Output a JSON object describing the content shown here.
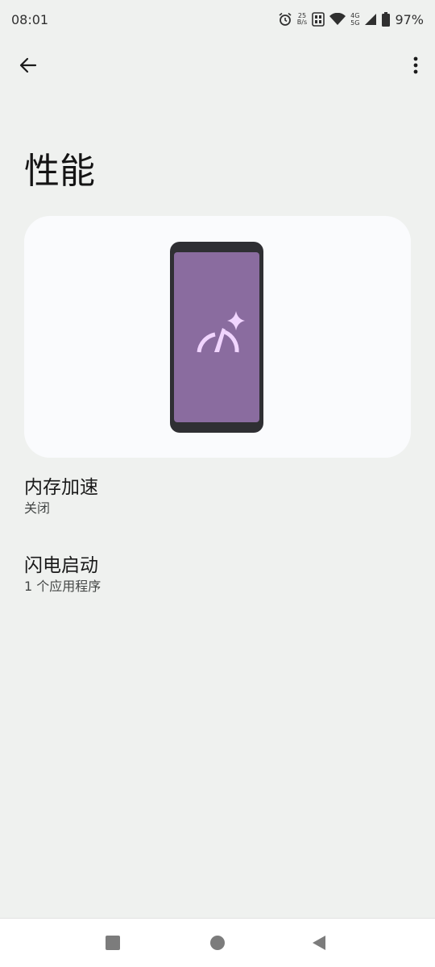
{
  "status_bar": {
    "time": "08:01",
    "net_speed_value": "25",
    "net_speed_unit": "B/s",
    "network_top": "4G",
    "network_bottom": "5G",
    "battery_percent": "97%",
    "icons": [
      "alarm-icon",
      "sim-icon",
      "wifi-icon",
      "signal-icon",
      "battery-icon"
    ]
  },
  "toolbar": {
    "back_icon": "arrow-back-icon",
    "more_icon": "more-vert-icon"
  },
  "page": {
    "title": "性能"
  },
  "hero": {
    "icon": "speedometer-sparkle-icon",
    "colors": {
      "screen": "#8a6c9f",
      "frame": "#2f2f33",
      "glyph": "#f1d5ff"
    }
  },
  "settings": [
    {
      "title": "内存加速",
      "summary": "关闭"
    },
    {
      "title": "闪电启动",
      "summary": "1 个应用程序"
    }
  ],
  "nav_bar": {
    "icons": [
      "recents-square-icon",
      "home-circle-icon",
      "back-triangle-icon"
    ]
  }
}
